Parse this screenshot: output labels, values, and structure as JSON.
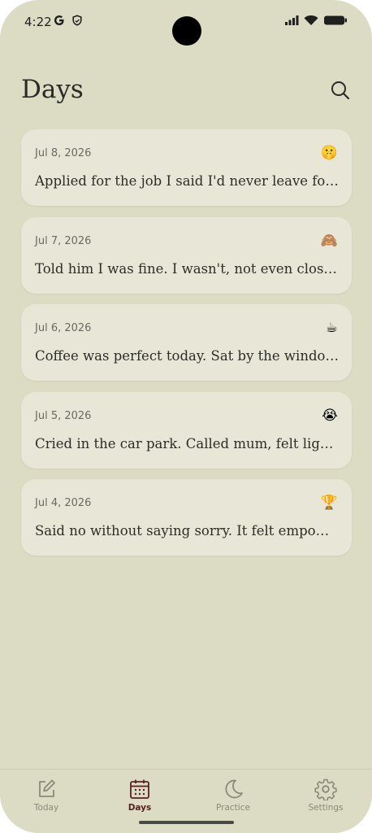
{
  "status_bar": {
    "time": "4:22"
  },
  "header": {
    "title": "Days"
  },
  "entries": [
    {
      "date": "Jul 8, 2026",
      "emoji": "🤫",
      "text": "Applied for the job I said I'd never leave for. …"
    },
    {
      "date": "Jul 7, 2026",
      "emoji": "🙈",
      "text": "Told him I was fine. I wasn't, not even close. …"
    },
    {
      "date": "Jul 6, 2026",
      "emoji": "☕",
      "text": "Coffee was perfect today. Sat by the window …"
    },
    {
      "date": "Jul 5, 2026",
      "emoji": "😭",
      "text": "Cried in the car park. Called mum, felt lighte…"
    },
    {
      "date": "Jul 4, 2026",
      "emoji": "🏆",
      "text": "Said no without saying sorry. It felt empower…"
    }
  ],
  "nav": {
    "today": "Today",
    "days": "Days",
    "practice": "Practice",
    "settings": "Settings"
  },
  "colors": {
    "background": "#dcdbc3",
    "card": "#e8e6d6",
    "active_nav": "#5a1f1f",
    "inactive_nav": "#8b8a7a"
  }
}
